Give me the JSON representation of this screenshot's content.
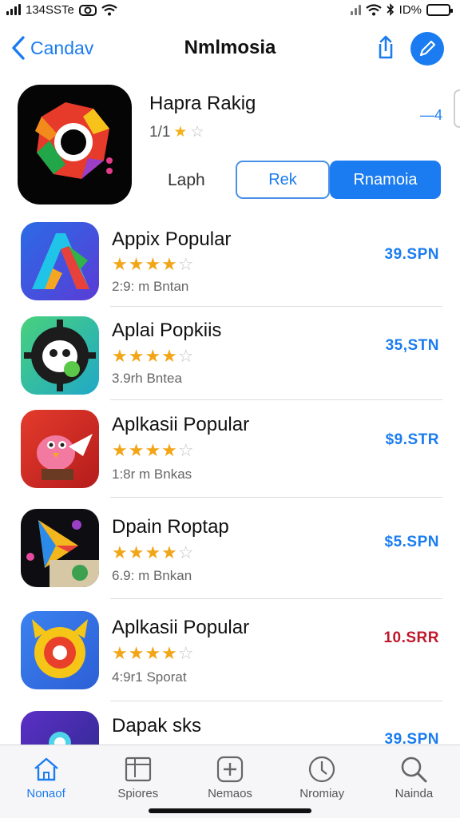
{
  "status_bar": {
    "left_text": "134SSTe",
    "right_text": "ID%",
    "icons": [
      "signal-icon",
      "camera-icon",
      "wifi-icon",
      "bluetooth-icon",
      "battery-icon"
    ]
  },
  "nav": {
    "back_label": "Candav",
    "title": "Nmlmosia",
    "icons": [
      "chevron-left-icon",
      "share-icon",
      "compose-icon"
    ],
    "accent_color": "#1a7cf0"
  },
  "header_app": {
    "name": "Hapra Rakig",
    "rating_text": "1/1",
    "stars_full": 1,
    "stars_empty": 1,
    "count": "—4",
    "label": "Laph",
    "button_outline": "Rek",
    "button_filled": "Rnamoia"
  },
  "apps": [
    {
      "name": "Appix Popular",
      "stars": 4.5,
      "meta": "2:9: m Bntan",
      "price": "39.SPN",
      "price_color": "#1a7cf0",
      "icon": "a-letter-app-icon"
    },
    {
      "name": "Aplai Popkiis",
      "stars": 4.5,
      "meta": "3.9rh Bntea",
      "price": "35,STN",
      "price_color": "#1a7cf0",
      "icon": "panda-gear-app-icon"
    },
    {
      "name": "Aplkasii Popular",
      "stars": 4.5,
      "meta": "1:8r m Bnkas",
      "price": "$9.STR",
      "price_color": "#1a7cf0",
      "icon": "pink-bird-app-icon"
    },
    {
      "name": "Dpain Roptap",
      "stars": 4.5,
      "meta": "6.9: m Bnkan",
      "price": "$5.SPN",
      "price_color": "#1a7cf0",
      "icon": "play-art-app-icon"
    },
    {
      "name": "Aplkasii Popular",
      "stars": 4.5,
      "meta": "4:9r1 Sporat",
      "price": "10.SRR",
      "price_color": "#c0182b",
      "icon": "yellow-target-app-icon"
    },
    {
      "name": "Dapak sks",
      "stars": 0,
      "meta": "",
      "price": "39.SPN",
      "price_color": "#1a7cf0",
      "icon": "purple-app-icon"
    }
  ],
  "tabs": [
    {
      "label": "Nonaof",
      "icon": "home-icon",
      "active": true
    },
    {
      "label": "Spiores",
      "icon": "stories-icon",
      "active": false
    },
    {
      "label": "Nemaos",
      "icon": "plus-square-icon",
      "active": false
    },
    {
      "label": "Nromiay",
      "icon": "clock-icon",
      "active": false
    },
    {
      "label": "Nainda",
      "icon": "search-icon",
      "active": false
    }
  ]
}
